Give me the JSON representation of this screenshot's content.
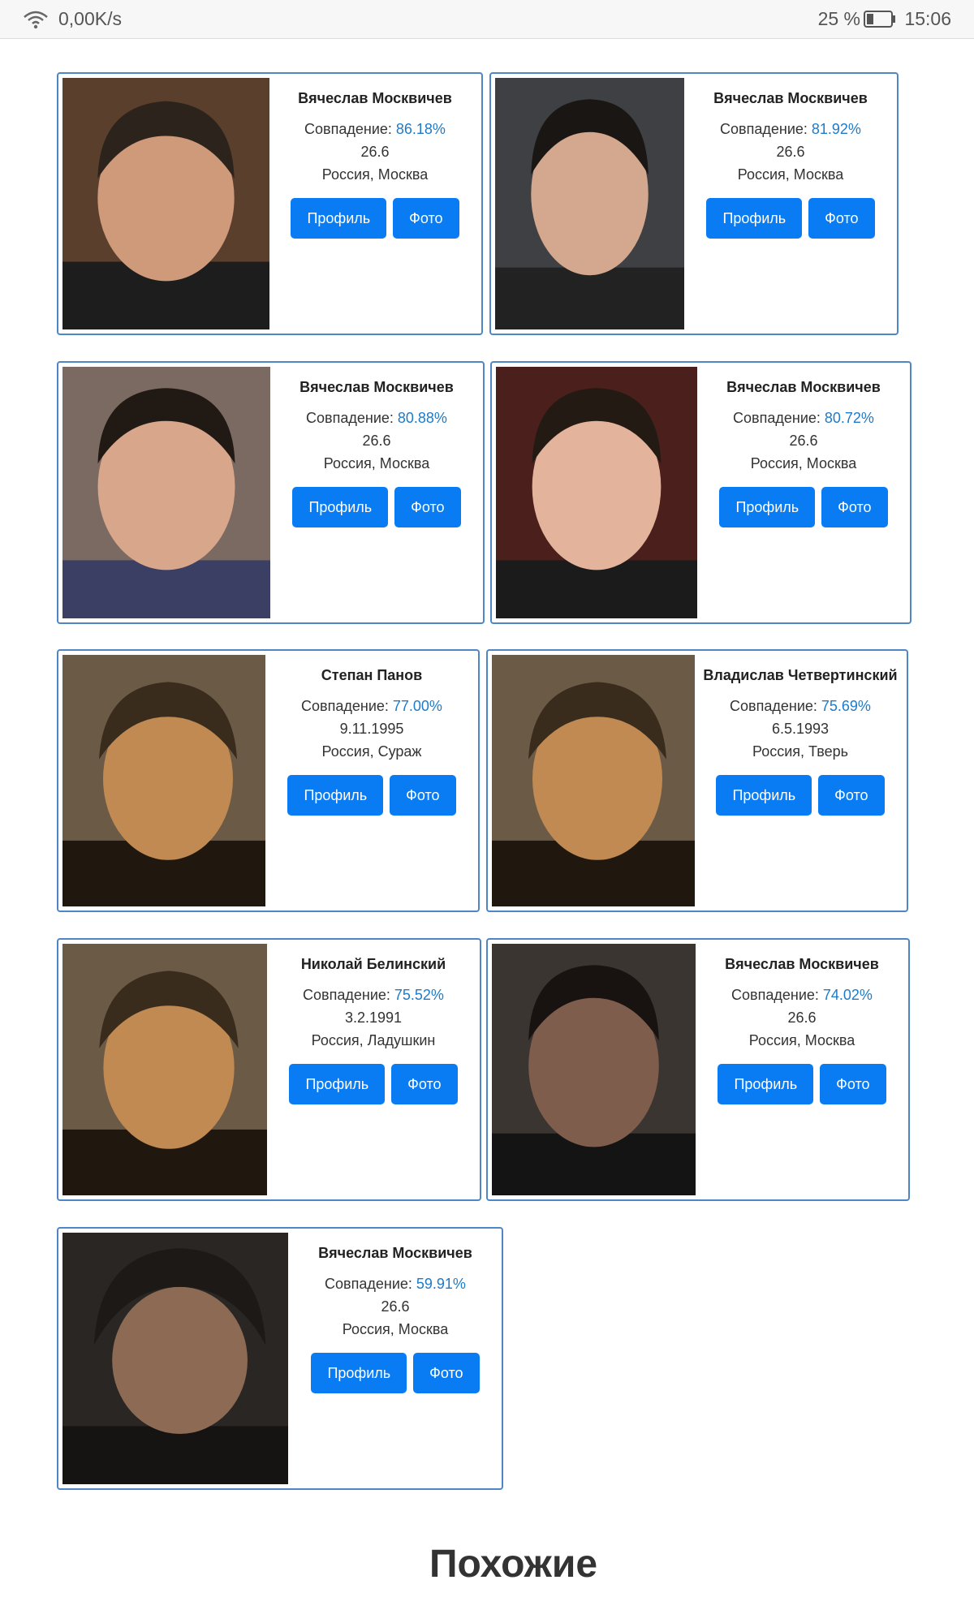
{
  "statusbar": {
    "speed": "0,00K/s",
    "battery": "25 %",
    "time": "15:06"
  },
  "labels": {
    "match": "Совпадение: ",
    "profile": "Профиль",
    "photo": "Фото"
  },
  "cards": [
    {
      "name": "Вячеслав Москвичев",
      "match": "86.18%",
      "date": "26.6",
      "location": "Россия, Москва"
    },
    {
      "name": "Вячеслав Москвичев",
      "match": "81.92%",
      "date": "26.6",
      "location": "Россия, Москва"
    },
    {
      "name": "Вячеслав Москвичев",
      "match": "80.88%",
      "date": "26.6",
      "location": "Россия, Москва"
    },
    {
      "name": "Вячеслав Москвичев",
      "match": "80.72%",
      "date": "26.6",
      "location": "Россия, Москва"
    },
    {
      "name": "Степан Панов",
      "match": "77.00%",
      "date": "9.11.1995",
      "location": "Россия, Сураж"
    },
    {
      "name": "Владислав Четвертинский",
      "match": "75.69%",
      "date": "6.5.1993",
      "location": "Россия, Тверь"
    },
    {
      "name": "Николай Белинский",
      "match": "75.52%",
      "date": "3.2.1991",
      "location": "Россия, Ладушкин"
    },
    {
      "name": "Вячеслав Москвичев",
      "match": "74.02%",
      "date": "26.6",
      "location": "Россия, Москва"
    },
    {
      "name": "Вячеслав Москвичев",
      "match": "59.91%",
      "date": "26.6",
      "location": "Россия, Москва"
    }
  ],
  "similar_heading": "Похожие",
  "colors": {
    "accent": "#0a7cf3",
    "card_border": "#4f86c6",
    "match_value": "#1f7bc8"
  }
}
